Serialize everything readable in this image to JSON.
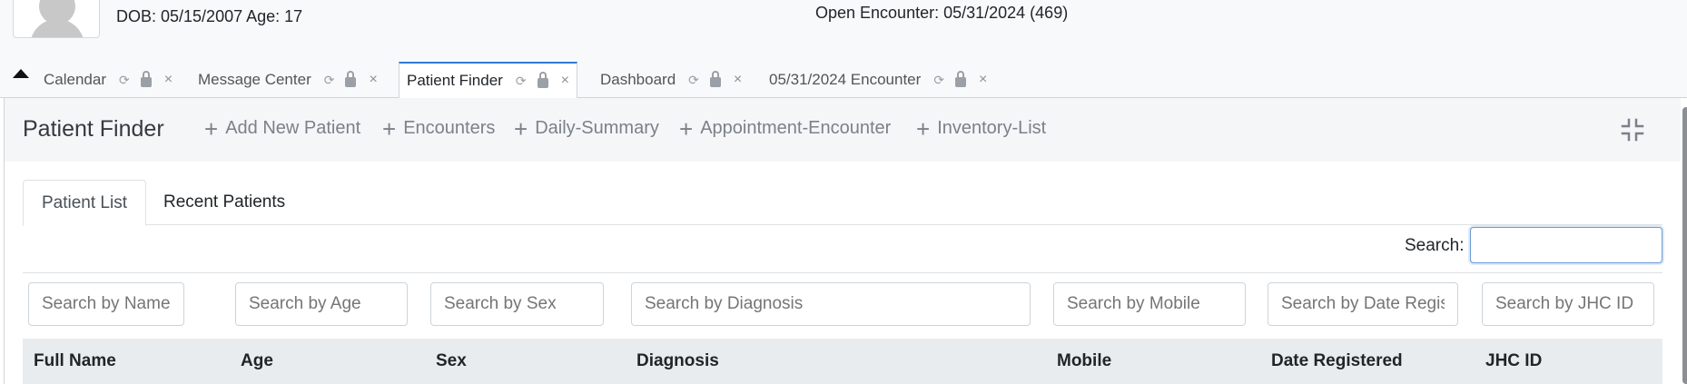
{
  "patient": {
    "dob_text": "DOB: 05/15/2007 Age: 17",
    "open_encounter": "Open Encounter: 05/31/2024 (469)"
  },
  "tabs": [
    {
      "label": "Calendar",
      "active": false
    },
    {
      "label": "Message Center",
      "active": false
    },
    {
      "label": "Patient Finder",
      "active": true
    },
    {
      "label": "Dashboard",
      "active": false
    },
    {
      "label": "05/31/2024 Encounter",
      "active": false
    }
  ],
  "tab_icons": {
    "refresh": "refresh-icon",
    "lock": "lock-icon",
    "close": "×"
  },
  "toolbar": {
    "title": "Patient Finder",
    "buttons": [
      {
        "label": "Add New Patient"
      },
      {
        "label": "Encounters"
      },
      {
        "label": "Daily-Summary"
      },
      {
        "label": "Appointment-Encounter"
      },
      {
        "label": "Inventory-List"
      }
    ],
    "plus": "+"
  },
  "subtabs": [
    {
      "label": "Patient List",
      "active": true
    },
    {
      "label": "Recent Patients",
      "active": false
    }
  ],
  "search": {
    "label": "Search:",
    "value": ""
  },
  "filters": [
    {
      "placeholder": "Search by Name"
    },
    {
      "placeholder": "Search by Age"
    },
    {
      "placeholder": "Search by Sex"
    },
    {
      "placeholder": "Search by Diagnosis"
    },
    {
      "placeholder": "Search by Mobile"
    },
    {
      "placeholder": "Search by Date Registered"
    },
    {
      "placeholder": "Search by JHC ID"
    }
  ],
  "columns": [
    "Full Name",
    "Age",
    "Sex",
    "Diagnosis",
    "Mobile",
    "Date Registered",
    "JHC ID"
  ],
  "colors": {
    "accent": "#2f7bd5",
    "header_bg": "#e9ecef"
  }
}
